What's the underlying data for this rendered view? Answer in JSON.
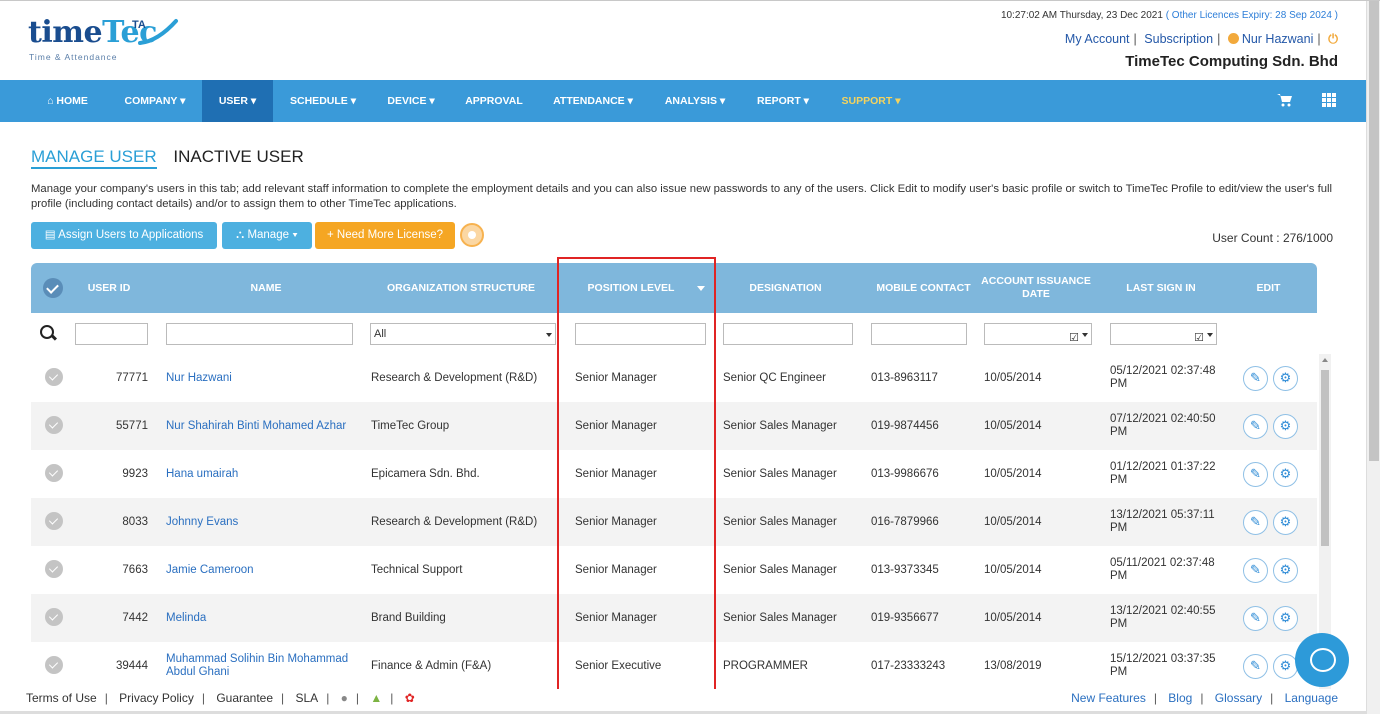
{
  "header": {
    "datetime": "10:27:02 AM Thursday, 23 Dec 2021",
    "licence_expiry": "( Other Licences Expiry: 28 Sep 2024 )",
    "my_account": "My Account",
    "subscription": "Subscription",
    "user_name": "Nur Hazwani",
    "company": "TimeTec Computing Sdn. Bhd",
    "logo": {
      "word1": "time",
      "word2": "Tec",
      "ta": "TA",
      "tagline": "Time & Attendance"
    }
  },
  "nav": [
    "HOME",
    "COMPANY ▾",
    "USER ▾",
    "SCHEDULE ▾",
    "DEVICE ▾",
    "APPROVAL",
    "ATTENDANCE ▾",
    "ANALYSIS ▾",
    "REPORT ▾",
    "SUPPORT ▾"
  ],
  "nav_icons": {
    "home": "home-icon",
    "cart": "cart-icon",
    "apps": "grid-icon"
  },
  "tabs": {
    "manage": "MANAGE USER",
    "inactive": "INACTIVE USER"
  },
  "description": "Manage your company's users in this tab; add relevant staff information to complete the employment details and you can also issue new passwords to any of the users. Click Edit to modify user's basic profile or switch to TimeTec Profile to edit/view the user's full profile (including contact details) and/or to assign them to other TimeTec applications.",
  "toolbar": {
    "assign": "Assign Users to Applications",
    "manage": "Manage ▾",
    "license": "+ Need More License?",
    "user_count": "User Count : 276/1000"
  },
  "table": {
    "headers": {
      "user_id": "USER ID",
      "name": "NAME",
      "org": "ORGANIZATION STRUCTURE",
      "position": "POSITION LEVEL",
      "designation": "DESIGNATION",
      "mobile": "MOBILE CONTACT",
      "issuance": "ACCOUNT ISSUANCE DATE",
      "last_sign": "LAST SIGN IN",
      "edit": "EDIT"
    },
    "org_filter_value": "All",
    "rows": [
      {
        "id": "77771",
        "name": "Nur Hazwani",
        "org": "Research & Development (R&D)",
        "position": "Senior Manager",
        "designation": "Senior QC Engineer",
        "mobile": "013-8963117",
        "issued": "10/05/2014",
        "last": "05/12/2021 02:37:48 PM"
      },
      {
        "id": "55771",
        "name": "Nur Shahirah Binti Mohamed Azhar",
        "org": "TimeTec Group",
        "position": "Senior Manager",
        "designation": "Senior Sales Manager",
        "mobile": "019-9874456",
        "issued": "10/05/2014",
        "last": "07/12/2021 02:40:50 PM"
      },
      {
        "id": "9923",
        "name": "Hana umairah",
        "org": "Epicamera Sdn. Bhd.",
        "position": "Senior Manager",
        "designation": "Senior Sales Manager",
        "mobile": "013-9986676",
        "issued": "10/05/2014",
        "last": "01/12/2021 01:37:22 PM"
      },
      {
        "id": "8033",
        "name": "Johnny Evans",
        "org": "Research & Development (R&D)",
        "position": "Senior Manager",
        "designation": "Senior Sales Manager",
        "mobile": "016-7879966",
        "issued": "10/05/2014",
        "last": "13/12/2021 05:37:11 PM"
      },
      {
        "id": "7663",
        "name": "Jamie Cameroon",
        "org": "Technical Support",
        "position": "Senior Manager",
        "designation": "Senior Sales Manager",
        "mobile": "013-9373345",
        "issued": "10/05/2014",
        "last": "05/11/2021 02:37:48 PM"
      },
      {
        "id": "7442",
        "name": "Melinda",
        "org": "Brand Building",
        "position": "Senior Manager",
        "designation": "Senior Sales Manager",
        "mobile": "019-9356677",
        "issued": "10/05/2014",
        "last": "13/12/2021 02:40:55 PM"
      },
      {
        "id": "39444",
        "name": "Muhammad Solihin Bin Mohammad Abdul Ghani",
        "org": "Finance & Admin (F&A)",
        "position": "Senior Executive",
        "designation": "PROGRAMMER",
        "mobile": "017-23333243",
        "issued": "13/08/2019",
        "last": "15/12/2021 03:37:35 PM"
      }
    ]
  },
  "footer": {
    "left": [
      "Terms of Use",
      "Privacy Policy",
      "Guarantee",
      "SLA"
    ],
    "right": [
      "New Features",
      "Blog",
      "Glossary",
      "Language"
    ]
  },
  "colors": {
    "nav": "#3a9ad9",
    "nav_active": "#1f6fb3",
    "highlight": "#e02424",
    "table_header": "#7fb7dc",
    "accent": "#f5a623"
  }
}
